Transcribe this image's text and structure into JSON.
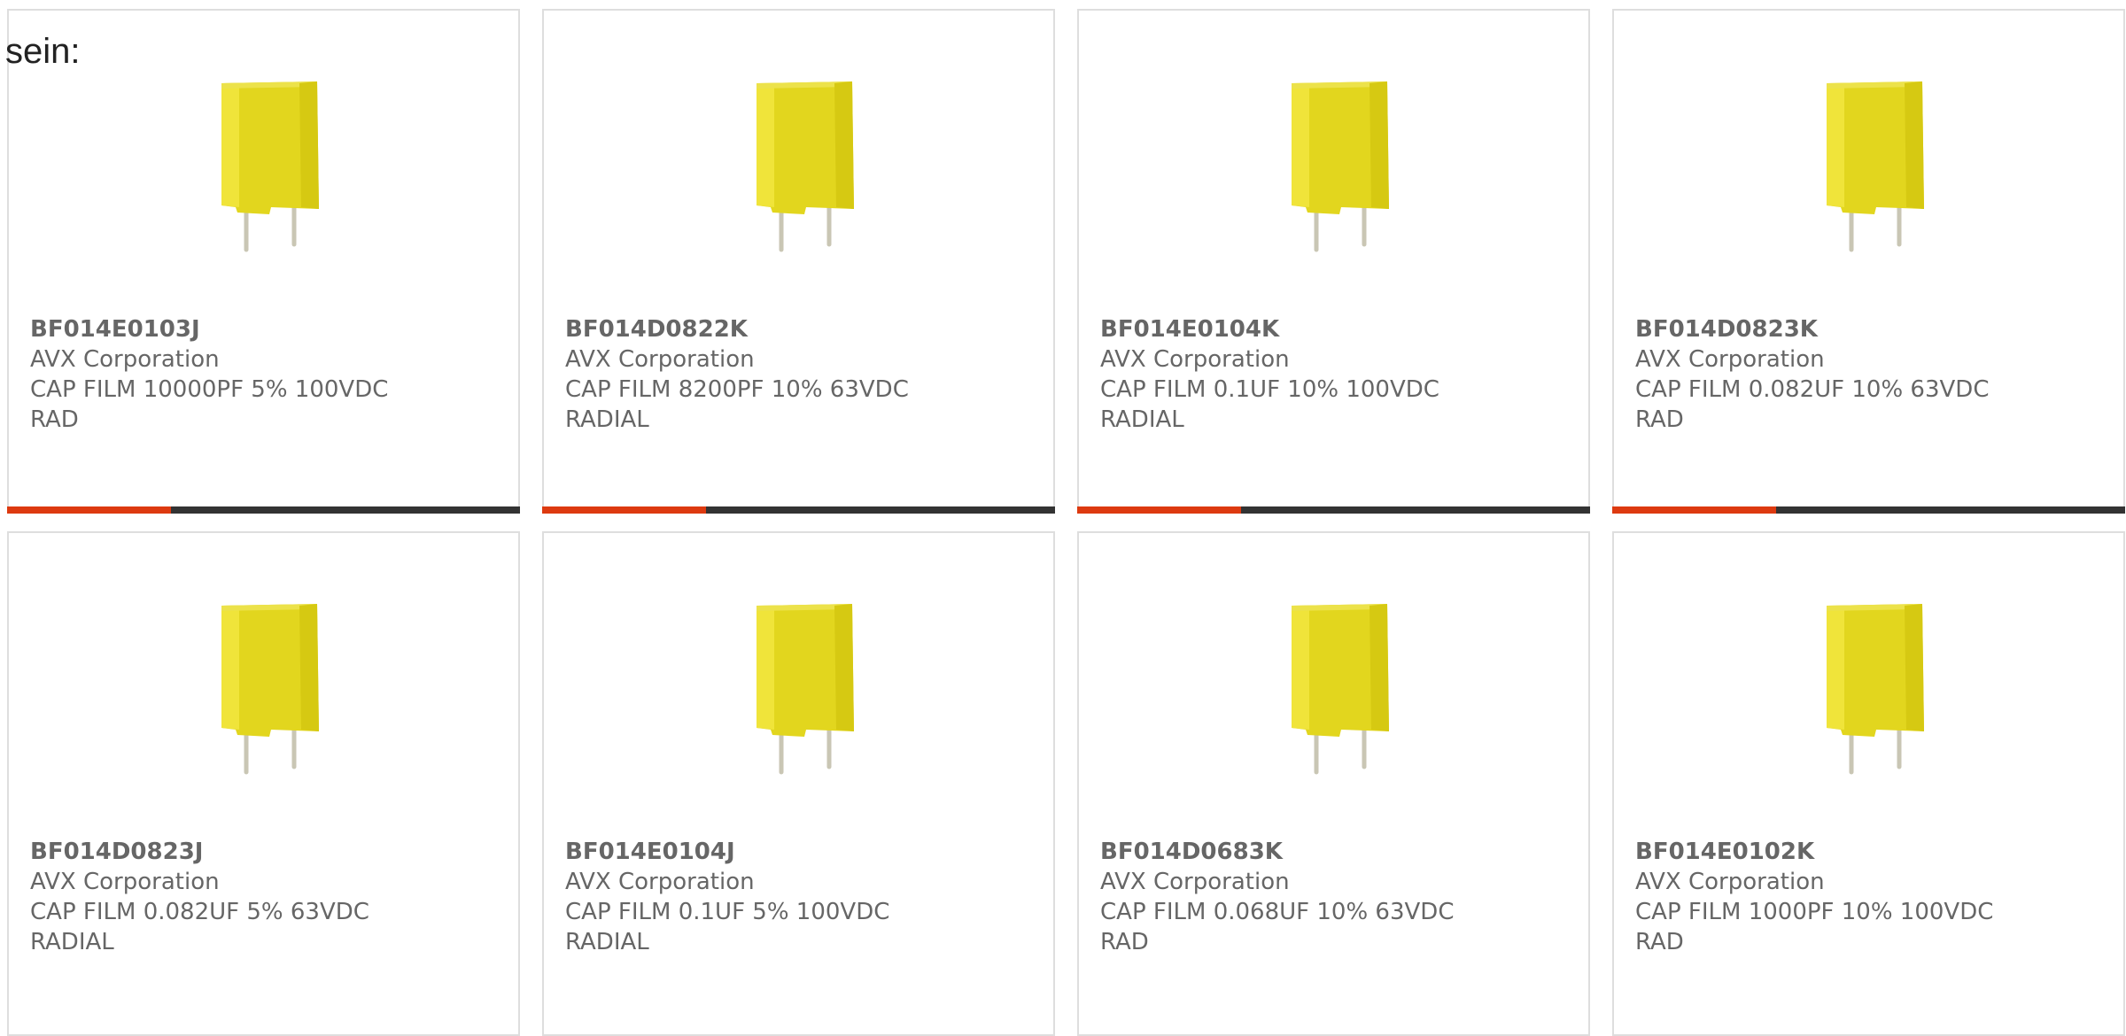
{
  "intro_text": "sein:",
  "accent_color": "#dd3a10",
  "products": [
    {
      "part_number": "BF014E0103J",
      "manufacturer": "AVX Corporation",
      "description": "CAP FILM 10000PF 5% 100VDC\nRAD",
      "icon": "film-capacitor-icon",
      "progress": 0.32
    },
    {
      "part_number": "BF014D0822K",
      "manufacturer": "AVX Corporation",
      "description": "CAP FILM 8200PF 10% 63VDC\nRADIAL",
      "icon": "film-capacitor-icon",
      "progress": 0.32
    },
    {
      "part_number": "BF014E0104K",
      "manufacturer": "AVX Corporation",
      "description": "CAP FILM 0.1UF 10% 100VDC\nRADIAL",
      "icon": "film-capacitor-icon",
      "progress": 0.32
    },
    {
      "part_number": "BF014D0823K",
      "manufacturer": "AVX Corporation",
      "description": "CAP FILM 0.082UF 10% 63VDC\nRAD",
      "icon": "film-capacitor-icon",
      "progress": 0.32
    },
    {
      "part_number": "BF014D0823J",
      "manufacturer": "AVX Corporation",
      "description": "CAP FILM 0.082UF 5% 63VDC\nRADIAL",
      "icon": "film-capacitor-icon"
    },
    {
      "part_number": "BF014E0104J",
      "manufacturer": "AVX Corporation",
      "description": "CAP FILM 0.1UF 5% 100VDC\nRADIAL",
      "icon": "film-capacitor-icon"
    },
    {
      "part_number": "BF014D0683K",
      "manufacturer": "AVX Corporation",
      "description": "CAP FILM 0.068UF 10% 63VDC\nRAD",
      "icon": "film-capacitor-icon"
    },
    {
      "part_number": "BF014E0102K",
      "manufacturer": "AVX Corporation",
      "description": "CAP FILM 1000PF 10% 100VDC\nRAD",
      "icon": "film-capacitor-icon"
    }
  ]
}
